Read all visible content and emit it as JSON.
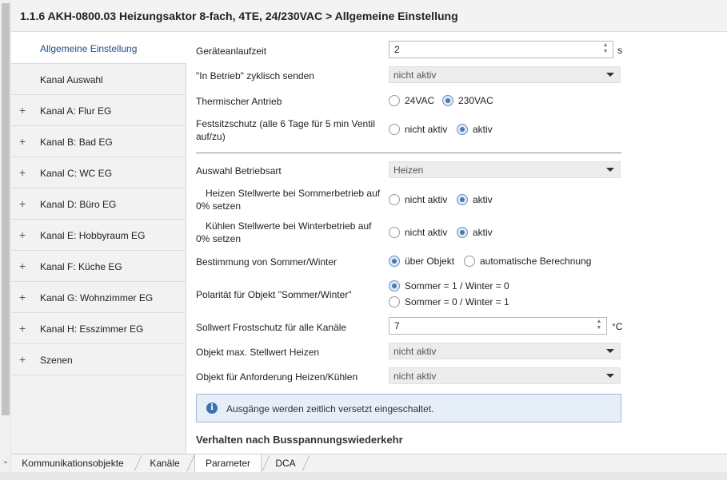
{
  "window": {
    "title": "1.1.6 AKH-0800.03 Heizungsaktor 8-fach, 4TE, 24/230VAC > Allgemeine Einstellung"
  },
  "sidebar": {
    "items": [
      {
        "label": "Allgemeine Einstellung",
        "expandable": false,
        "active": true
      },
      {
        "label": "Kanal Auswahl",
        "expandable": false,
        "active": false
      },
      {
        "label": "Kanal A: Flur EG",
        "expandable": true,
        "active": false
      },
      {
        "label": "Kanal B: Bad EG",
        "expandable": true,
        "active": false
      },
      {
        "label": "Kanal C: WC EG",
        "expandable": true,
        "active": false
      },
      {
        "label": "Kanal D: Büro EG",
        "expandable": true,
        "active": false
      },
      {
        "label": "Kanal E: Hobbyraum EG",
        "expandable": true,
        "active": false
      },
      {
        "label": "Kanal F: Küche EG",
        "expandable": true,
        "active": false
      },
      {
        "label": "Kanal G: Wohnzimmer EG",
        "expandable": true,
        "active": false
      },
      {
        "label": "Kanal H: Esszimmer EG",
        "expandable": true,
        "active": false
      },
      {
        "label": "Szenen",
        "expandable": true,
        "active": false
      }
    ],
    "expand_glyph": "+"
  },
  "params": {
    "startup_delay": {
      "label": "Geräteanlaufzeit",
      "value": "2",
      "unit": "s"
    },
    "in_operation": {
      "label": "\"In Betrieb\" zyklisch senden",
      "value": "nicht aktiv"
    },
    "thermal_drive": {
      "label": "Thermischer Antrieb",
      "options": [
        "24VAC",
        "230VAC"
      ],
      "selected": "230VAC"
    },
    "seize_protection": {
      "label": "Festsitzschutz (alle 6 Tage für 5 min Ventil auf/zu)",
      "options": [
        "nicht aktiv",
        "aktiv"
      ],
      "selected": "aktiv"
    },
    "operating_mode": {
      "label": "Auswahl Betriebsart",
      "value": "Heizen"
    },
    "heat_summer": {
      "label": "Heizen Stellwerte bei Sommerbetrieb auf 0% setzen",
      "options": [
        "nicht aktiv",
        "aktiv"
      ],
      "selected": "aktiv"
    },
    "cool_winter": {
      "label": "Kühlen Stellwerte bei Winterbetrieb auf 0% setzen",
      "options": [
        "nicht aktiv",
        "aktiv"
      ],
      "selected": "aktiv"
    },
    "summer_winter": {
      "label": "Bestimmung von Sommer/Winter",
      "options": [
        "über Objekt",
        "automatische Berechnung"
      ],
      "selected": "über Objekt"
    },
    "polarity": {
      "label": "Polarität für Objekt \"Sommer/Winter\"",
      "options": [
        "Sommer = 1 / Winter = 0",
        "Sommer = 0 / Winter = 1"
      ],
      "selected": "Sommer = 1 / Winter = 0"
    },
    "frost_setpoint": {
      "label": "Sollwert Frostschutz für alle Kanäle",
      "value": "7",
      "unit": "°C"
    },
    "max_heat_obj": {
      "label": "Objekt max. Stellwert Heizen",
      "value": "nicht aktiv"
    },
    "heat_cool_req": {
      "label": "Objekt für Anforderung Heizen/Kühlen",
      "value": "nicht aktiv"
    }
  },
  "info": {
    "icon": "info-icon",
    "text": "Ausgänge werden zeitlich versetzt eingeschaltet."
  },
  "section": {
    "heading": "Verhalten nach Busspannungswiederkehr"
  },
  "tabs": [
    {
      "label": "Kommunikationsobjekte",
      "active": false
    },
    {
      "label": "Kanäle",
      "active": false
    },
    {
      "label": "Parameter",
      "active": true
    },
    {
      "label": "DCA",
      "active": false
    }
  ],
  "colors": {
    "accent": "#1f4e8c",
    "radio_selected": "#4a78b0",
    "info_bg": "#e6eef7",
    "info_icon": "#3d6fae"
  }
}
